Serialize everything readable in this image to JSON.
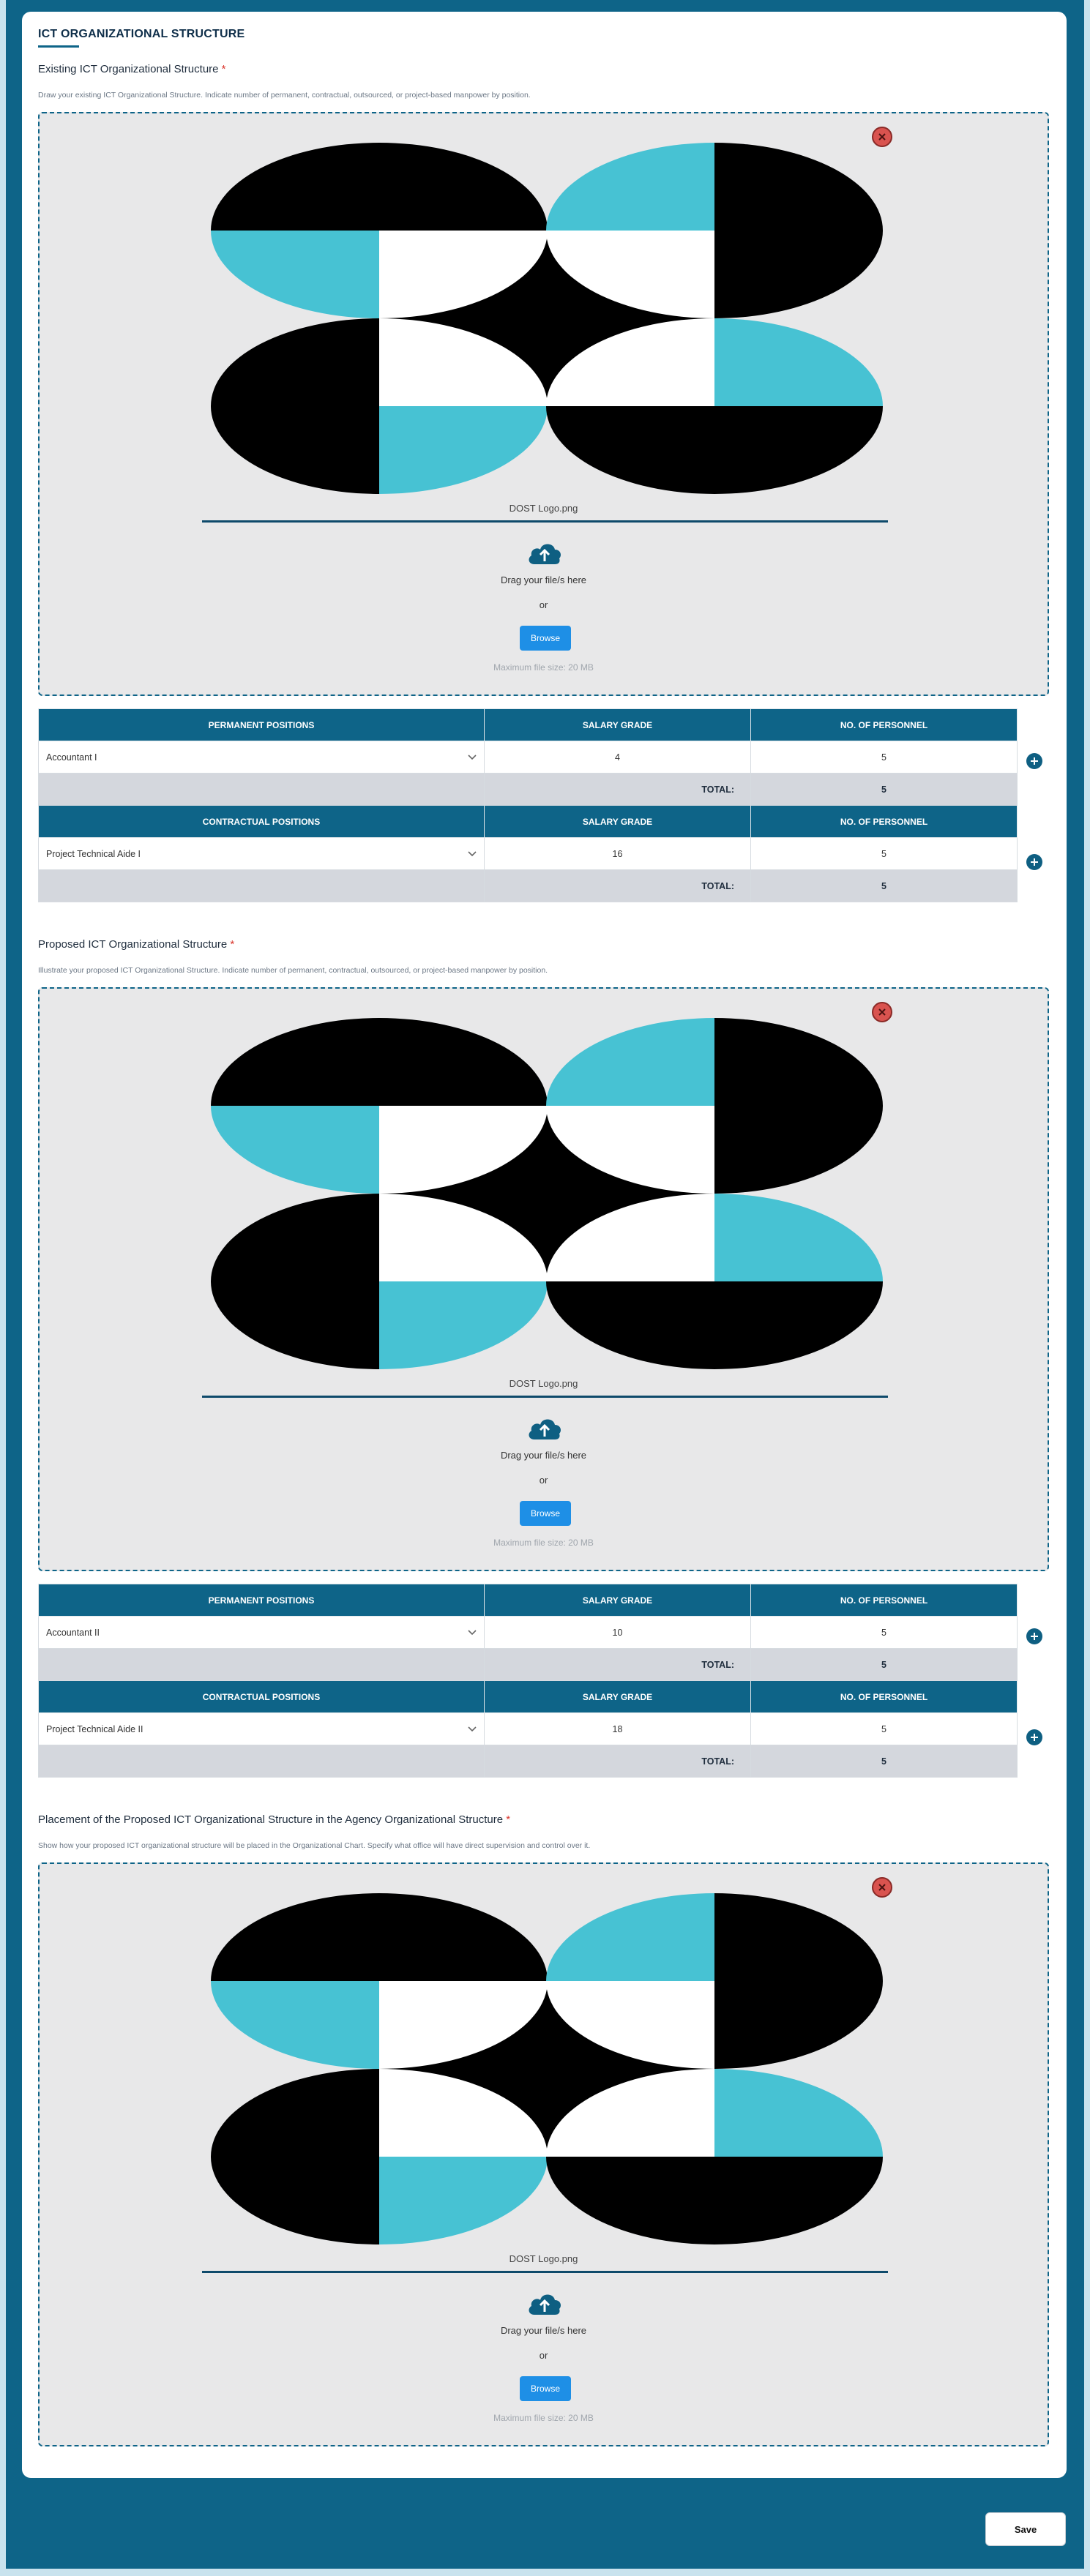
{
  "section_title": "ICT ORGANIZATIONAL STRUCTURE",
  "colors": {
    "accent": "#0e6488",
    "browse": "#1e8fe6",
    "required": "#d9342b",
    "logo_cyan": "#47c2d3"
  },
  "upload": {
    "filename": "DOST Logo.png",
    "drag_text": "Drag your file/s here",
    "or_text": "or",
    "browse_label": "Browse",
    "max_size": "Maximum file size: 20 MB",
    "remove_icon": "close-circle-icon",
    "upload_icon": "cloud-upload-icon"
  },
  "existing": {
    "label": "Existing ICT Organizational Structure",
    "required_mark": "*",
    "description": "Draw your existing ICT Organizational Structure. Indicate number of permanent, contractual, outsourced, or project-based manpower by position."
  },
  "proposed": {
    "label": "Proposed ICT Organizational Structure",
    "required_mark": "*",
    "description": "Illustrate your proposed ICT Organizational Structure. Indicate number of permanent, contractual, outsourced, or project-based manpower by position."
  },
  "placement": {
    "label": "Placement of the Proposed ICT Organizational Structure in the Agency Organizational Structure",
    "required_mark": "*",
    "description": "Show how your proposed ICT organizational structure will be placed in the Organizational Chart. Specify what office will have direct supervision and control over it."
  },
  "existing_table": {
    "permanent_header": "PERMANENT POSITIONS",
    "contractual_header": "CONTRACTUAL POSITIONS",
    "salary_header": "SALARY GRADE",
    "personnel_header": "NO. OF PERSONNEL",
    "total_label": "TOTAL:",
    "permanent_row": {
      "position": "Accountant I",
      "salary": "4",
      "personnel": "5"
    },
    "permanent_total": "5",
    "contractual_row": {
      "position": "Project Technical Aide I",
      "salary": "16",
      "personnel": "5"
    },
    "contractual_total": "5"
  },
  "proposed_table": {
    "permanent_header": "PERMANENT POSITIONS",
    "contractual_header": "CONTRACTUAL POSITIONS",
    "salary_header": "SALARY GRADE",
    "personnel_header": "NO. OF PERSONNEL",
    "total_label": "TOTAL:",
    "permanent_row": {
      "position": "Accountant II",
      "salary": "10",
      "personnel": "5"
    },
    "permanent_total": "5",
    "contractual_row": {
      "position": "Project Technical Aide II",
      "salary": "18",
      "personnel": "5"
    },
    "contractual_total": "5"
  },
  "save_label": "Save"
}
